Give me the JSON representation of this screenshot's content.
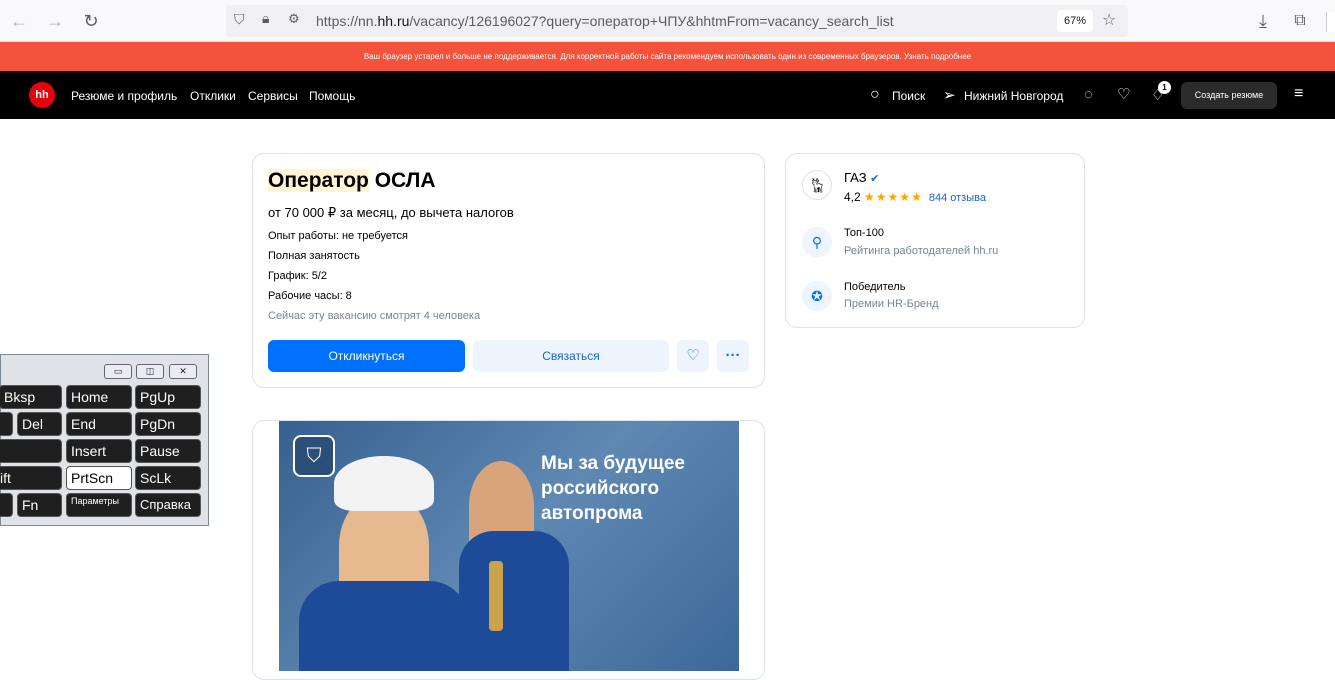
{
  "browser": {
    "url_prefix": "https://nn.",
    "url_host": "hh.ru",
    "url_rest": "/vacancy/126196027?query=оператор+ЧПУ&hhtmFrom=vacancy_search_list",
    "zoom": "67%"
  },
  "warning": "Ваш браузер устарел и больше не поддерживается. Для корректной работы сайта рекомендуем использовать один из современных браузеров. Узнать подробнее",
  "header": {
    "logo": "hh",
    "nav": [
      "Резюме и профиль",
      "Отклики",
      "Сервисы",
      "Помощь"
    ],
    "search": "Поиск",
    "city": "Нижний Новгород",
    "notif_count": "1",
    "create_resume": "Создать резюме"
  },
  "vacancy": {
    "title_highlight": "Оператор",
    "title_rest": " ОСЛА",
    "salary": "от 70 000 ₽ за месяц, до вычета налогов",
    "experience": "Опыт работы: не требуется",
    "employment": "Полная занятость",
    "schedule": "График: 5/2",
    "hours": "Рабочие часы: 8",
    "watching": "Сейчас эту вакансию смотрят 4 человека",
    "respond_label": "Откликнуться",
    "contact_label": "Связаться"
  },
  "employer": {
    "name": "ГАЗ",
    "rating": "4,2",
    "stars": "★★★★★",
    "reviews": "844 отзыва",
    "award1_title": "Топ-100",
    "award1_sub": "Рейтинга работодателей hh.ru",
    "award2_title": "Победитель",
    "award2_sub": "Премии HR-Бренд"
  },
  "banner": {
    "line1": "Мы за будущее",
    "line2": "российского",
    "line3": "автопрома"
  },
  "osk": {
    "keys": [
      "Bksp",
      "Home",
      "PgUp",
      "Del",
      "End",
      "PgDn",
      "Insert",
      "Pause",
      "ift",
      "PrtScn",
      "ScLk",
      "Fn",
      "Параметры",
      "Справка"
    ]
  },
  "colors": {
    "accent": "#0070ff",
    "warning_bg": "#f5523b",
    "brand_red": "#e8000a"
  }
}
